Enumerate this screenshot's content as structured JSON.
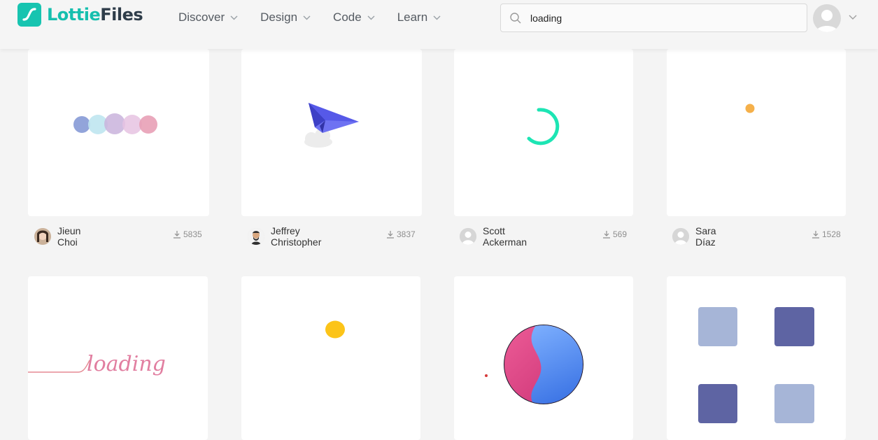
{
  "brand": {
    "name_part1": "Lottie",
    "name_part2": "Files",
    "primary_color": "#16bfae",
    "dark_color": "#2f3d4a"
  },
  "nav": {
    "items": [
      {
        "label": "Discover"
      },
      {
        "label": "Design"
      },
      {
        "label": "Code"
      },
      {
        "label": "Learn"
      }
    ]
  },
  "search": {
    "value": "loading",
    "icon": "search-icon"
  },
  "user_menu": {
    "icon": "user-avatar-icon",
    "chevron": "chevron-down-icon"
  },
  "animations": [
    {
      "author": "Jieun Choi",
      "downloads": "5835",
      "preview": "colored-dots"
    },
    {
      "author": "Jeffrey Christopher",
      "downloads": "3837",
      "preview": "paper-plane"
    },
    {
      "author": "Scott Ackerman",
      "downloads": "569",
      "preview": "green-spinner-arc"
    },
    {
      "author": "Sara Díaz",
      "downloads": "1528",
      "preview": "orange-dot"
    },
    {
      "author": "",
      "downloads": "",
      "preview": "loading-handwriting",
      "preview_text": "loading"
    },
    {
      "author": "",
      "downloads": "",
      "preview": "yellow-blob"
    },
    {
      "author": "",
      "downloads": "",
      "preview": "blue-pink-sphere"
    },
    {
      "author": "",
      "downloads": "",
      "preview": "four-squares"
    }
  ],
  "colors": {
    "download_count": "#8e8e8e",
    "spinner": "#1de5b4",
    "orange_dot": "#f5b04a",
    "yellow_blob": "#fcc419",
    "square_light": "#a6b5d7",
    "square_dark": "#5e64a3"
  }
}
